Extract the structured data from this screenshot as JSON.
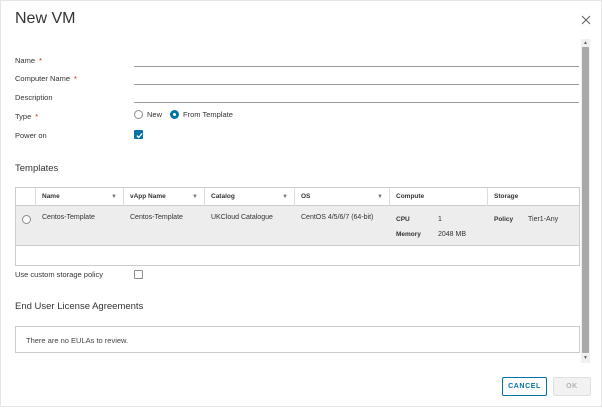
{
  "dialog": {
    "title": "New VM"
  },
  "form": {
    "name_label": "Name",
    "computer_name_label": "Computer Name",
    "description_label": "Description",
    "type_label": "Type",
    "required_mark": "*",
    "type_options": [
      "New",
      "From Template"
    ],
    "type_selected": "From Template",
    "power_on_label": "Power on",
    "power_on_checked": true,
    "name_value": "",
    "computer_name_value": "",
    "description_value": ""
  },
  "templates": {
    "title": "Templates",
    "columns": [
      "Name",
      "vApp Name",
      "Catalog",
      "OS",
      "Compute",
      "Storage"
    ],
    "rows": [
      {
        "name": "Centos-Template",
        "vapp_name": "Centos-Template",
        "catalog": "UKCloud Catalogue",
        "os": "CentOS 4/5/6/7 (64-bit)",
        "cpu_label": "CPU",
        "cpu_value": "1",
        "memory_label": "Memory",
        "memory_value": "2048 MB",
        "policy_label": "Policy",
        "policy_value": "Tier1-Any"
      }
    ]
  },
  "storage": {
    "custom_policy_label": "Use custom storage policy",
    "custom_policy_checked": false
  },
  "eula": {
    "title": "End User License Agreements",
    "empty_text": "There are no EULAs to review."
  },
  "footer": {
    "cancel_label": "CANCEL",
    "ok_label": "OK"
  },
  "colors": {
    "accent": "#0072a3",
    "required": "#c92100",
    "selected_row": "#ededed"
  }
}
